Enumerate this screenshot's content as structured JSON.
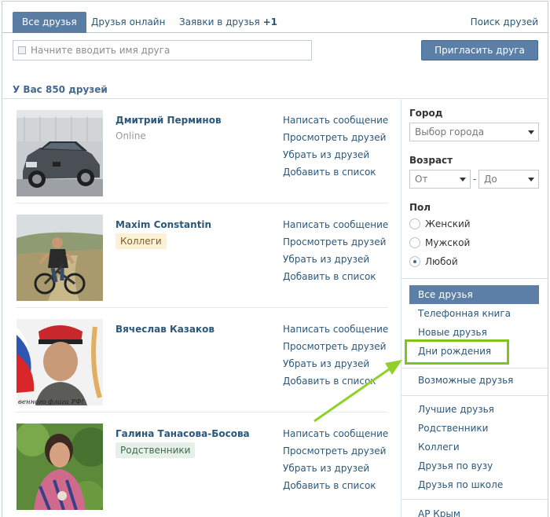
{
  "tabs": {
    "all": "Все друзья",
    "online": "Друзья онлайн",
    "requests": "Заявки в друзья",
    "requests_badge": "+1",
    "search": "Поиск друзей"
  },
  "search": {
    "placeholder": "Начните вводить имя друга"
  },
  "invite_button": "Пригласить друга",
  "summary": "У Вас 850 друзей",
  "actions": {
    "message": "Написать сообщение",
    "view_friends": "Просмотреть друзей",
    "remove": "Убрать из друзей",
    "add_to_list": "Добавить в список"
  },
  "friends": [
    {
      "name": "Дмитрий Перминов",
      "status": "Online",
      "tag": ""
    },
    {
      "name": "Maxim Constantin",
      "status": "",
      "tag": "Коллеги"
    },
    {
      "name": "Вячеслав Казаков",
      "status": "",
      "tag": "",
      "photo_caption": "венного флага РФ!"
    },
    {
      "name": "Галина Танасова-Босова",
      "status": "",
      "tag": "Родственники"
    }
  ],
  "filters": {
    "city_label": "Город",
    "city_value": "Выбор города",
    "age_label": "Возраст",
    "age_from": "От",
    "age_to": "До",
    "age_dash": "-",
    "gender_label": "Пол",
    "gender_options": [
      "Женский",
      "Мужской",
      "Любой"
    ],
    "gender_selected": "Любой"
  },
  "menu": {
    "all_friends": "Все друзья",
    "phone_book": "Телефонная книга",
    "new_friends": "Новые друзья",
    "birthdays": "Дни рождения",
    "possible_friends": "Возможные друзья",
    "best_friends": "Лучшие друзья",
    "relatives": "Родственники",
    "colleagues": "Коллеги",
    "uni_friends": "Друзья по вузу",
    "school_friends": "Друзья по школе",
    "ar_crimea": "АР Крым"
  },
  "colors": {
    "accent": "#5b7fa6",
    "link": "#2b587a",
    "highlight": "#7fc41d"
  }
}
